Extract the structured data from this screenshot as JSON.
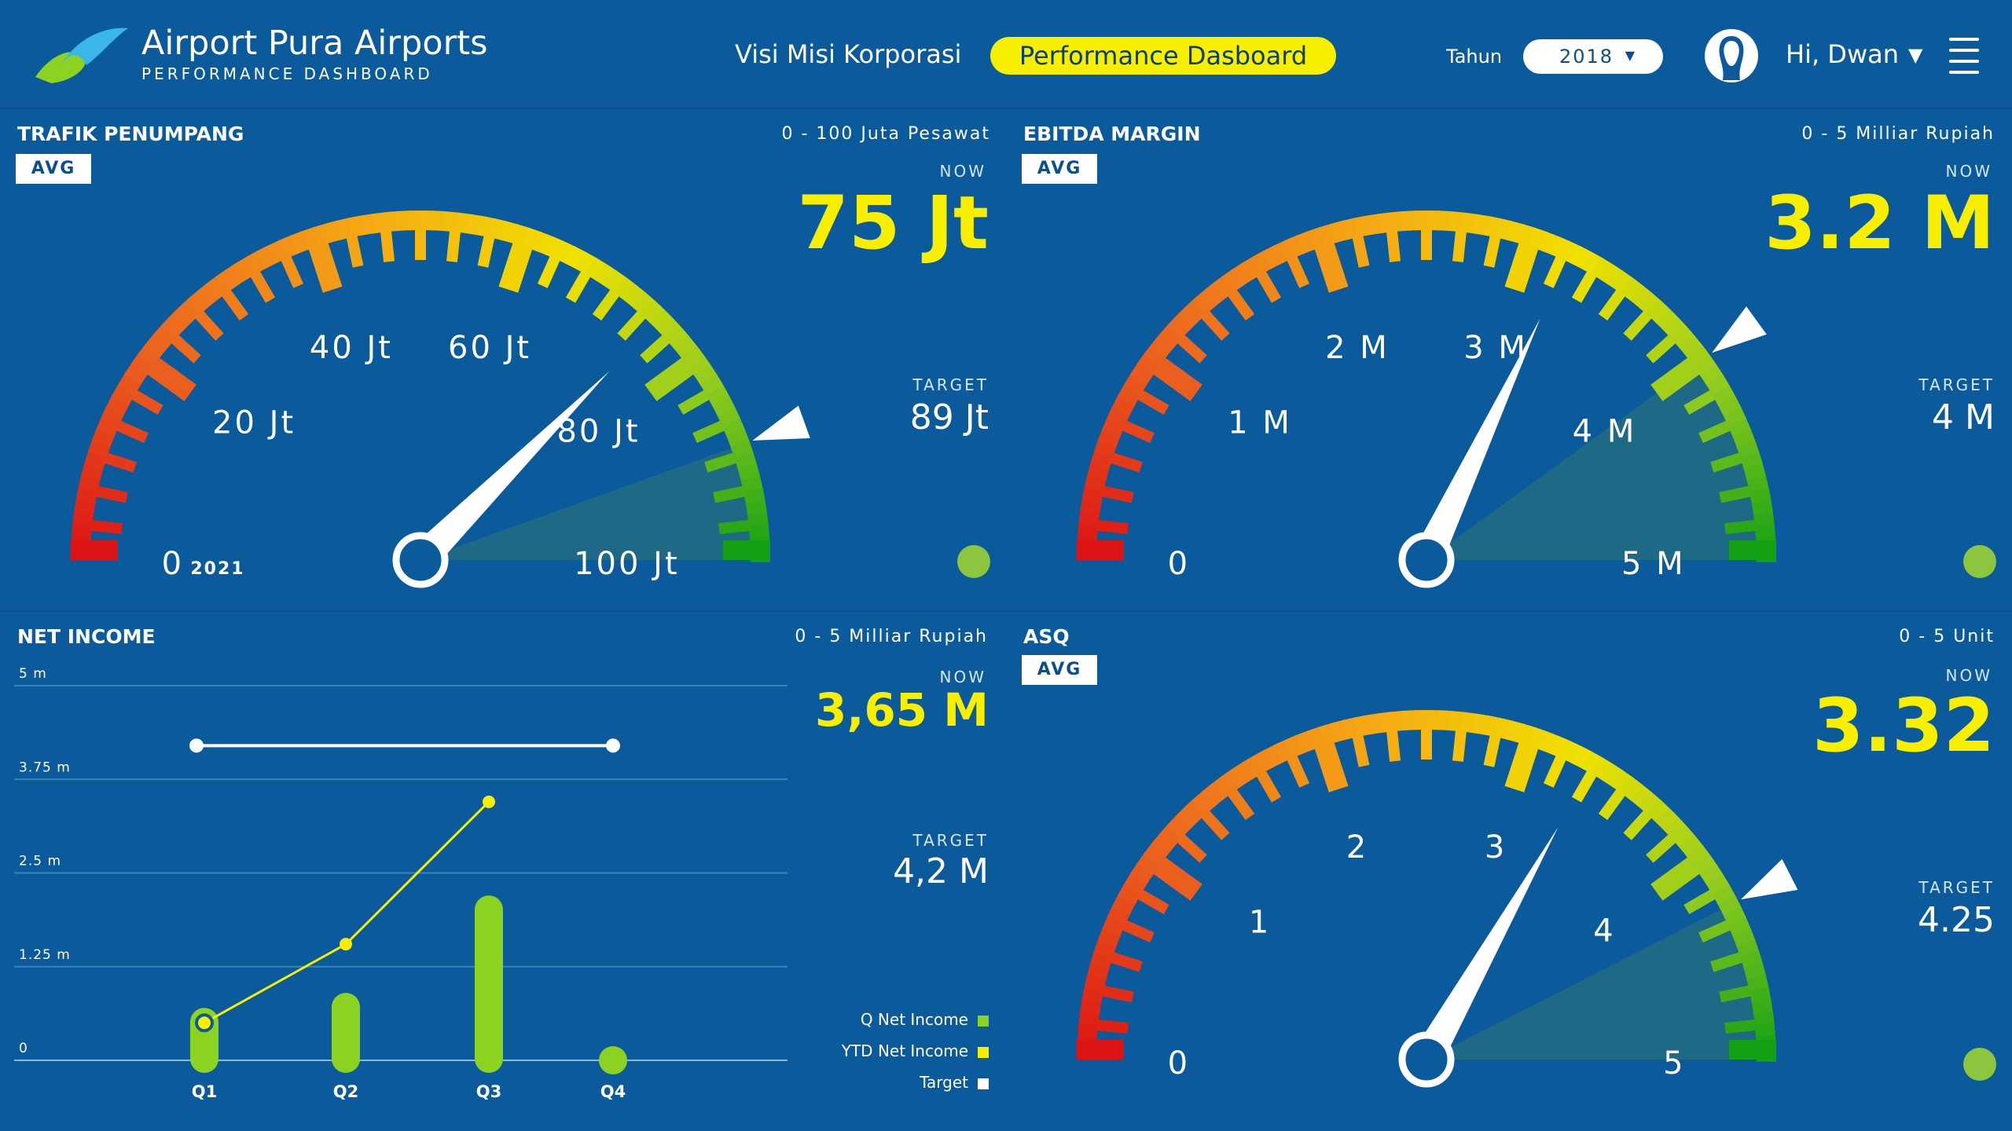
{
  "header": {
    "app_title": "Airport Pura Airports",
    "app_subtitle": "PERFORMANCE DASHBOARD",
    "nav_link": "Visi Misi Korporasi",
    "nav_active": "Performance Dasboard",
    "year_label": "Tahun",
    "year_value": "2018",
    "year_caret": "▼",
    "user_greeting": "Hi, Dwan",
    "user_caret": "▼"
  },
  "panels": {
    "trafik": {
      "title": "TRAFIK PENUMPANG",
      "range": "0 - 100 Juta Pesawat",
      "avg_label": "AVG",
      "now_label": "NOW",
      "now_value": "75 Jt",
      "target_label": "TARGET",
      "target_value": "89 Jt",
      "year_tag": "2021",
      "gauge": {
        "min": 0,
        "max": 100,
        "value": 75,
        "target": 89,
        "labels": [
          "0",
          "20 Jt",
          "40 Jt",
          "60 Jt",
          "80 Jt",
          "100 Jt"
        ]
      },
      "status_color": "#8cc63f"
    },
    "ebitda": {
      "title": "EBITDA MARGIN",
      "range": "0 - 5 Milliar Rupiah",
      "avg_label": "AVG",
      "now_label": "NOW",
      "now_value": "3.2 M",
      "target_label": "TARGET",
      "target_value": "4 M",
      "gauge": {
        "min": 0,
        "max": 5,
        "value": 3.2,
        "target": 4,
        "labels": [
          "0",
          "1 M",
          "2 M",
          "3 M",
          "4 M",
          "5 M"
        ]
      },
      "status_color": "#8cc63f"
    },
    "net_income": {
      "title": "NET INCOME",
      "range": "0 - 5 Milliar Rupiah",
      "now_label": "NOW",
      "now_value": "3,65 M",
      "target_label": "TARGET",
      "target_value": "4,2 M",
      "legend": [
        {
          "label": "Q Net Income",
          "color": "#8cd321"
        },
        {
          "label": "YTD Net Income",
          "color": "#f7ee00"
        },
        {
          "label": "Target",
          "color": "#ffffff"
        }
      ]
    },
    "asq": {
      "title": "ASQ",
      "range": "0 - 5 Unit",
      "avg_label": "AVG",
      "now_label": "NOW",
      "now_value": "3.32",
      "target_label": "TARGET",
      "target_value": "4.25",
      "gauge": {
        "min": 0,
        "max": 5,
        "value": 3.32,
        "target": 4.25,
        "labels": [
          "0",
          "1",
          "2",
          "3",
          "4",
          "5"
        ]
      },
      "status_color": "#8cc63f"
    }
  },
  "chart_data": {
    "type": "bar",
    "categories": [
      "Q1",
      "Q2",
      "Q3",
      "Q4"
    ],
    "ylim": [
      0,
      5
    ],
    "yticks": [
      "0",
      "1.25 m",
      "2.5 m",
      "3.75 m",
      "5 m"
    ],
    "series": [
      {
        "name": "Q Net Income",
        "type": "bar",
        "values": [
          0.7,
          0.9,
          2.2,
          0
        ]
      },
      {
        "name": "YTD Net Income",
        "type": "line",
        "values": [
          0.5,
          1.55,
          3.45,
          null
        ]
      },
      {
        "name": "Target",
        "type": "line",
        "values": [
          4.2,
          4.2,
          4.2,
          4.2
        ]
      }
    ]
  }
}
